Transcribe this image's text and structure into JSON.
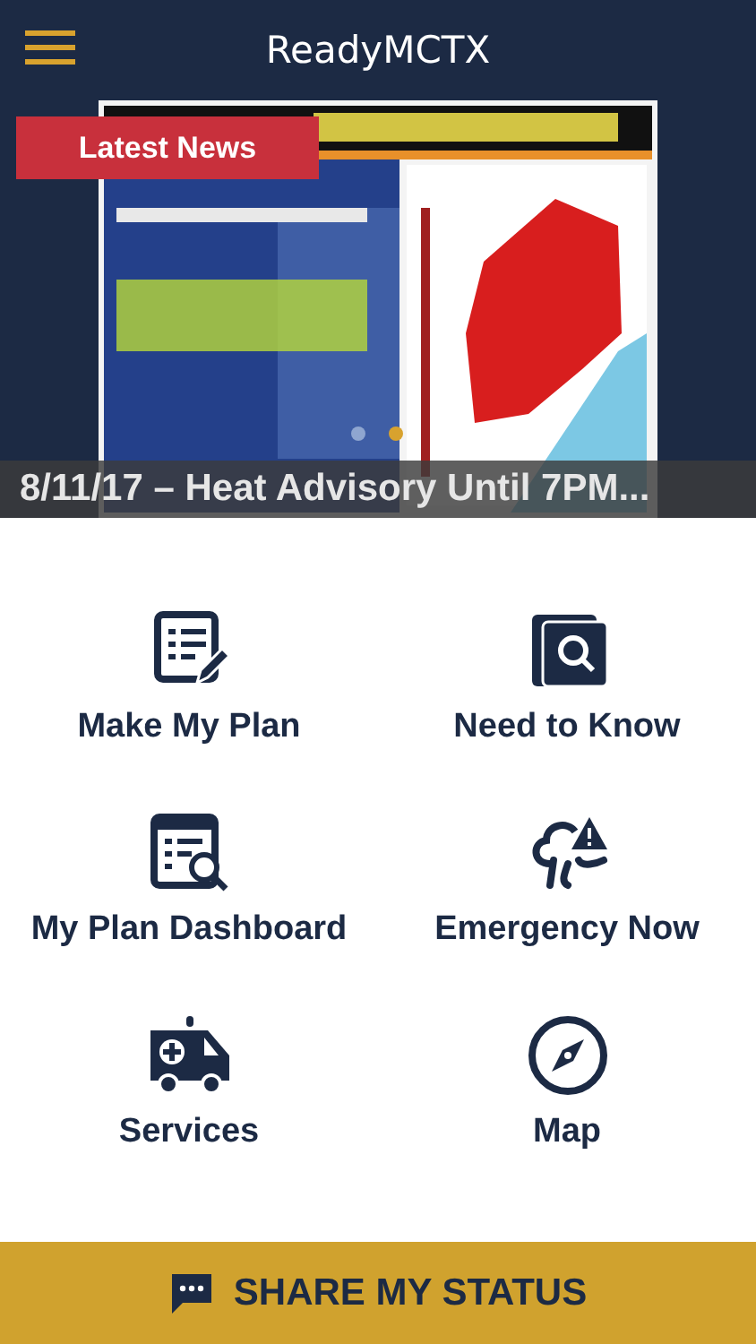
{
  "header": {
    "title": "ReadyMCTX"
  },
  "news": {
    "badge": "Latest News",
    "caption": "8/11/17 – Heat Advisory Until 7PM...",
    "pager": [
      {
        "selected": false
      },
      {
        "selected": true
      }
    ]
  },
  "tiles": [
    {
      "kind": "plan",
      "label": "Make My Plan"
    },
    {
      "kind": "know",
      "label": "Need to Know"
    },
    {
      "kind": "dashboard",
      "label": "My Plan Dashboard"
    },
    {
      "kind": "emergency",
      "label": "Emergency Now"
    },
    {
      "kind": "services",
      "label": "Services"
    },
    {
      "kind": "map",
      "label": "Map"
    }
  ],
  "share_button": {
    "label": "SHARE MY STATUS"
  }
}
